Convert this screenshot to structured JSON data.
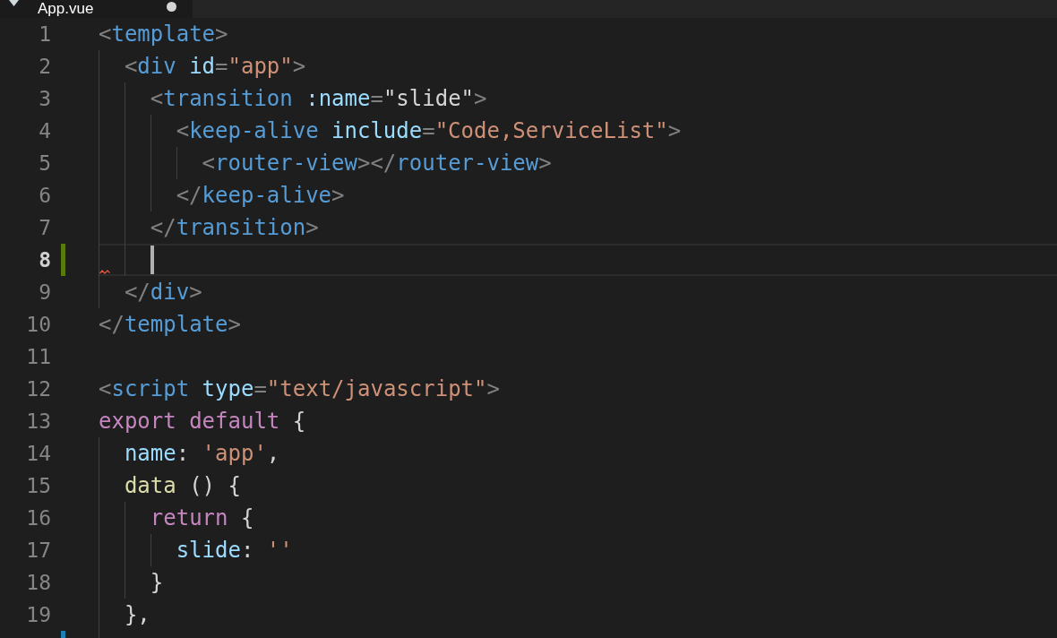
{
  "tab": {
    "label": "App.vue",
    "dirty": true
  },
  "lines": [
    {
      "number": "1",
      "current": false,
      "tokens": [
        {
          "kind": "punct",
          "text": "<"
        },
        {
          "kind": "tag",
          "text": "template"
        },
        {
          "kind": "punct",
          "text": ">"
        }
      ]
    },
    {
      "number": "2",
      "current": false,
      "tokens": [
        {
          "kind": "punct",
          "text": "  <"
        },
        {
          "kind": "tag",
          "text": "div"
        },
        {
          "kind": "attr",
          "text": " id"
        },
        {
          "kind": "punct",
          "text": "="
        },
        {
          "kind": "string",
          "text": "\"app\""
        },
        {
          "kind": "punct",
          "text": ">"
        }
      ]
    },
    {
      "number": "3",
      "current": false,
      "tokens": [
        {
          "kind": "punct",
          "text": "    <"
        },
        {
          "kind": "tag",
          "text": "transition"
        },
        {
          "kind": "attr",
          "text": " :name"
        },
        {
          "kind": "punct",
          "text": "="
        },
        {
          "kind": "plain",
          "text": "\"slide\""
        },
        {
          "kind": "punct",
          "text": ">"
        }
      ]
    },
    {
      "number": "4",
      "current": false,
      "tokens": [
        {
          "kind": "punct",
          "text": "      <"
        },
        {
          "kind": "tag",
          "text": "keep-alive"
        },
        {
          "kind": "attr",
          "text": " include"
        },
        {
          "kind": "punct",
          "text": "="
        },
        {
          "kind": "string",
          "text": "\"Code,ServiceList\""
        },
        {
          "kind": "punct",
          "text": ">"
        }
      ]
    },
    {
      "number": "5",
      "current": false,
      "tokens": [
        {
          "kind": "punct",
          "text": "        <"
        },
        {
          "kind": "tag",
          "text": "router-view"
        },
        {
          "kind": "punct",
          "text": "></"
        },
        {
          "kind": "tag",
          "text": "router-view"
        },
        {
          "kind": "punct",
          "text": ">"
        }
      ]
    },
    {
      "number": "6",
      "current": false,
      "tokens": [
        {
          "kind": "punct",
          "text": "      </"
        },
        {
          "kind": "tag",
          "text": "keep-alive"
        },
        {
          "kind": "punct",
          "text": ">"
        }
      ]
    },
    {
      "number": "7",
      "current": false,
      "tokens": [
        {
          "kind": "punct",
          "text": "    </"
        },
        {
          "kind": "tag",
          "text": "transition"
        },
        {
          "kind": "punct",
          "text": ">"
        }
      ]
    },
    {
      "number": "8",
      "current": true,
      "added": true,
      "error": true
    },
    {
      "number": "9",
      "current": false,
      "tokens": [
        {
          "kind": "punct",
          "text": "  </"
        },
        {
          "kind": "tag",
          "text": "div"
        },
        {
          "kind": "punct",
          "text": ">"
        }
      ]
    },
    {
      "number": "10",
      "current": false,
      "tokens": [
        {
          "kind": "punct",
          "text": "</"
        },
        {
          "kind": "tag",
          "text": "template"
        },
        {
          "kind": "punct",
          "text": ">"
        }
      ]
    },
    {
      "number": "11",
      "current": false
    },
    {
      "number": "12",
      "current": false,
      "tokens": [
        {
          "kind": "punct",
          "text": "<"
        },
        {
          "kind": "tag",
          "text": "script"
        },
        {
          "kind": "attr",
          "text": " type"
        },
        {
          "kind": "punct",
          "text": "="
        },
        {
          "kind": "string",
          "text": "\"text/javascript\""
        },
        {
          "kind": "punct",
          "text": ">"
        }
      ]
    },
    {
      "number": "13",
      "current": false,
      "tokens": [
        {
          "kind": "keyword",
          "text": "export"
        },
        {
          "kind": "keyword",
          "text": " default"
        },
        {
          "kind": "plain",
          "text": " {"
        }
      ]
    },
    {
      "number": "14",
      "current": false,
      "tokens": [
        {
          "kind": "attr",
          "text": "  name"
        },
        {
          "kind": "plain",
          "text": ": "
        },
        {
          "kind": "string",
          "text": "'app'"
        },
        {
          "kind": "plain",
          "text": ","
        }
      ]
    },
    {
      "number": "15",
      "current": false,
      "tokens": [
        {
          "kind": "func",
          "text": "  data"
        },
        {
          "kind": "plain",
          "text": " () {"
        }
      ]
    },
    {
      "number": "16",
      "current": false,
      "tokens": [
        {
          "kind": "keyword",
          "text": "    return"
        },
        {
          "kind": "plain",
          "text": " {"
        }
      ]
    },
    {
      "number": "17",
      "current": false,
      "tokens": [
        {
          "kind": "attr",
          "text": "      slide"
        },
        {
          "kind": "plain",
          "text": ": "
        },
        {
          "kind": "string",
          "text": "''"
        }
      ]
    },
    {
      "number": "18",
      "current": false,
      "tokens": [
        {
          "kind": "plain",
          "text": "    }"
        }
      ]
    },
    {
      "number": "19",
      "current": false,
      "tokens": [
        {
          "kind": "plain",
          "text": "  },"
        }
      ]
    },
    {
      "current": false,
      "modified": true
    }
  ]
}
